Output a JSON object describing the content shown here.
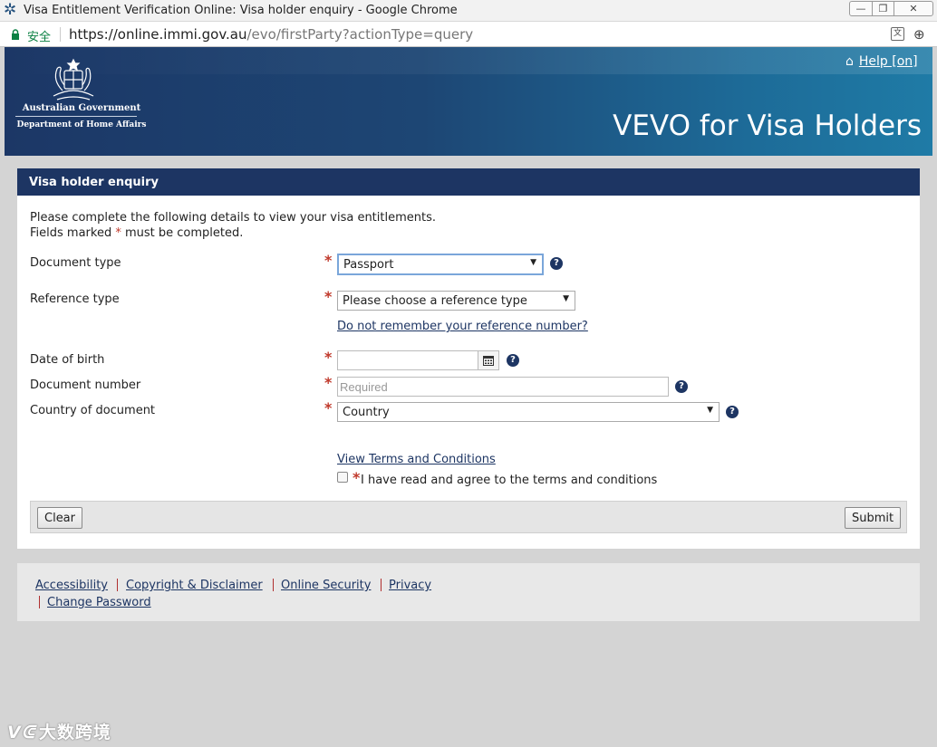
{
  "window": {
    "title": "Visa Entitlement Verification Online: Visa holder enquiry - Google Chrome",
    "min_glyph": "—",
    "max_glyph": "❐",
    "close_glyph": "✕"
  },
  "address_bar": {
    "secure_label": "安全",
    "url_host": "https://online.immi.gov.au",
    "url_path": "/evo/firstParty?actionType=query",
    "translate_glyph": "文",
    "zoom_glyph": "⊕"
  },
  "banner": {
    "gov_name": "Australian Government",
    "department": "Department of Home Affairs",
    "help_label": "Help [on]",
    "app_title": "VEVO for Visa Holders"
  },
  "form": {
    "header": "Visa holder enquiry",
    "intro_line1": "Please complete the following details to view your visa entitlements.",
    "intro_line2_before": "Fields marked ",
    "intro_line2_star": "*",
    "intro_line2_after": " must be completed.",
    "required_mark": "*",
    "help_mark": "?",
    "document_type": {
      "label": "Document type",
      "value": "Passport"
    },
    "reference_type": {
      "label": "Reference type",
      "value": "Please choose a reference type"
    },
    "forgot_reference_link": "Do not remember your reference number?",
    "date_of_birth": {
      "label": "Date of birth",
      "value": ""
    },
    "document_number": {
      "label": "Document number",
      "placeholder": "Required"
    },
    "country_of_document": {
      "label": "Country of document",
      "value": "Country"
    },
    "terms_link": "View Terms and Conditions",
    "agree_label": "I have read and agree to the terms and conditions",
    "clear_button": "Clear",
    "submit_button": "Submit"
  },
  "footer": {
    "links": [
      "Accessibility",
      "Copyright & Disclaimer",
      "Online Security",
      "Privacy",
      "Change Password"
    ]
  },
  "watermark": {
    "logo": "ᐯᕳ",
    "text": "大数跨境"
  },
  "colors": {
    "navy": "#1d3563",
    "required_red": "#c0392b",
    "banner_start": "#1c3766",
    "banner_end": "#1f7ba6"
  }
}
